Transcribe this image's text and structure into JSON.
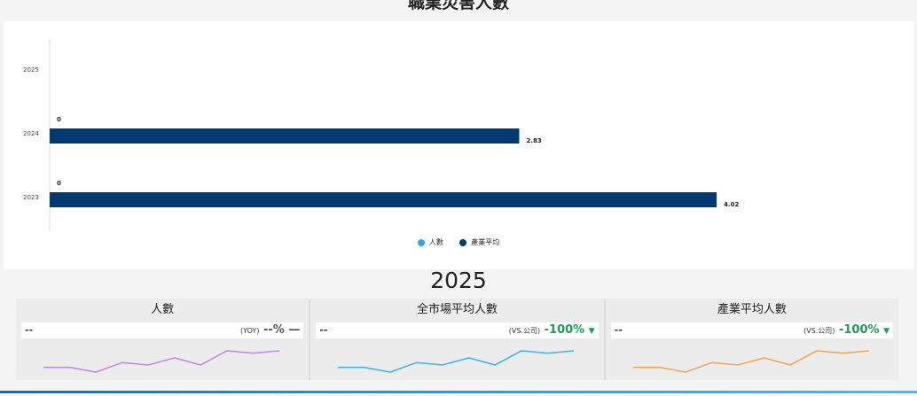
{
  "page_title": "職業災害人數",
  "chart_data": {
    "type": "bar",
    "title": "職業災害人數",
    "categories": [
      "2025",
      "2024",
      "2023"
    ],
    "series": [
      {
        "name": "人數",
        "color": "#29a8e0",
        "values": [
          null,
          0,
          0
        ]
      },
      {
        "name": "產業平均",
        "color": "#003a70",
        "values": [
          null,
          2.83,
          4.02
        ]
      }
    ],
    "data_labels": {
      "人數": [
        "",
        "0",
        "0"
      ],
      "產業平均": [
        "",
        "2.83",
        "4.02"
      ]
    },
    "xlim": [
      0,
      4.8
    ],
    "legend_position": "bottom",
    "grid": false
  },
  "legend": [
    {
      "label": "人數",
      "color": "#29a8e0"
    },
    {
      "label": "產業平均",
      "color": "#003a70"
    }
  ],
  "year_heading": "2025",
  "kpis": [
    {
      "title": "人數",
      "value": "--",
      "compare_label": "(YOY)",
      "compare_value": "--%",
      "compare_icon": "dash-icon",
      "compare_symbol": "—",
      "status_color": "#333333",
      "spark_color": "#c38be6",
      "spark": [
        6,
        6,
        4,
        8,
        7,
        10,
        7,
        13,
        12,
        13
      ]
    },
    {
      "title": "全市場平均人數",
      "value": "--",
      "compare_label": "(VS.公司)",
      "compare_value": "-100%",
      "compare_icon": "triangle-down-icon",
      "compare_symbol": "▼",
      "status_color": "#1e9b55",
      "spark_color": "#45b5e5",
      "spark": [
        6,
        6,
        4,
        8,
        7,
        10,
        7,
        13,
        12,
        13
      ]
    },
    {
      "title": "產業平均人數",
      "value": "--",
      "compare_label": "(VS.公司)",
      "compare_value": "-100%",
      "compare_icon": "triangle-down-icon",
      "compare_symbol": "▼",
      "status_color": "#1e9b55",
      "spark_color": "#f4a65a",
      "spark": [
        6,
        6,
        4,
        8,
        7,
        10,
        7,
        13,
        12,
        13
      ]
    }
  ]
}
